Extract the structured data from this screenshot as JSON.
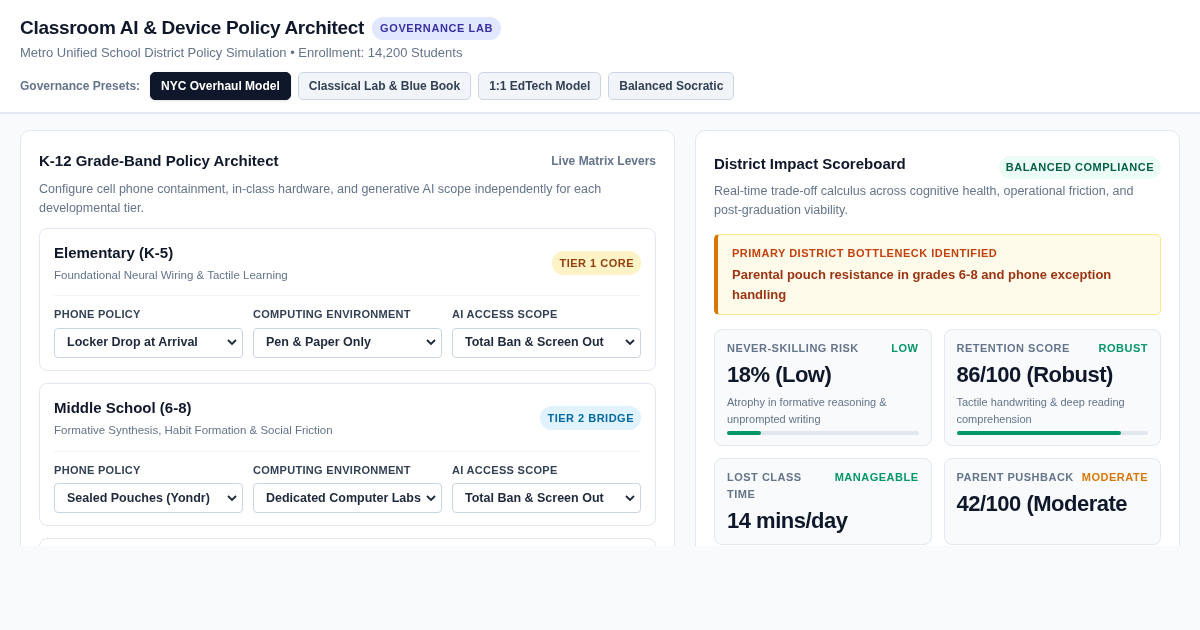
{
  "header": {
    "title": "Classroom AI & Device Policy Architect",
    "badge": "GOVERNANCE LAB",
    "subtitle": "Metro Unified School District Policy Simulation • Enrollment: 14,200 Students",
    "presets_label": "Governance Presets:",
    "presets": [
      {
        "label": "NYC Overhaul Model",
        "selected": true
      },
      {
        "label": "Classical Lab & Blue Book",
        "selected": false
      },
      {
        "label": "1:1 EdTech Model",
        "selected": false
      },
      {
        "label": "Balanced Socratic",
        "selected": false
      }
    ]
  },
  "architect": {
    "title": "K-12 Grade-Band Policy Architect",
    "link": "Live Matrix Levers",
    "description": "Configure cell phone containment, in-class hardware, and generative AI scope independently for each developmental tier.",
    "tiers": [
      {
        "name": "Elementary (K-5)",
        "focus": "Foundational Neural Wiring & Tactile Learning",
        "badge": "TIER 1 CORE",
        "color": "#fef3c7",
        "controls": [
          {
            "label": "PHONE POLICY",
            "value": "Locker Drop at Arrival"
          },
          {
            "label": "COMPUTING ENVIRONMENT",
            "value": "Pen & Paper Only"
          },
          {
            "label": "AI ACCESS SCOPE",
            "value": "Total Ban & Screen Out"
          }
        ]
      },
      {
        "name": "Middle School (6-8)",
        "focus": "Formative Synthesis, Habit Formation & Social Friction",
        "badge": "TIER 2 BRIDGE",
        "color": "#e0f2fe",
        "controls": [
          {
            "label": "PHONE POLICY",
            "value": "Sealed Pouches (Yondr)"
          },
          {
            "label": "COMPUTING ENVIRONMENT",
            "value": "Dedicated Computer Labs"
          },
          {
            "label": "AI ACCESS SCOPE",
            "value": "Total Ban & Screen Out"
          }
        ]
      }
    ]
  },
  "scoreboard": {
    "title": "District Impact Scoreboard",
    "badge": "BALANCED COMPLIANCE",
    "description": "Real-time trade-off calculus across cognitive health, operational friction, and post-graduation viability.",
    "alert": {
      "heading": "PRIMARY DISTRICT BOTTLENECK IDENTIFIED",
      "text": "Parental pouch resistance in grades 6-8 and phone exception handling"
    },
    "metrics": [
      {
        "label": "NEVER-SKILLING RISK",
        "status": "LOW",
        "color": "#059669",
        "value": "18% (Low)",
        "note": "Atrophy in formative reasoning & unprompted writing",
        "level": 0.18
      },
      {
        "label": "RETENTION SCORE",
        "status": "ROBUST",
        "color": "#059669",
        "value": "86/100 (Robust)",
        "note": "Tactile handwriting & deep reading comprehension",
        "level": 0.86
      },
      {
        "label": "LOST CLASS TIME",
        "status": "MANAGEABLE",
        "color": "#059669",
        "value": "14 mins/day"
      },
      {
        "label": "PARENT PUSHBACK",
        "status": "MODERATE",
        "color": "#d97706",
        "value": "42/100 (Moderate"
      }
    ]
  }
}
